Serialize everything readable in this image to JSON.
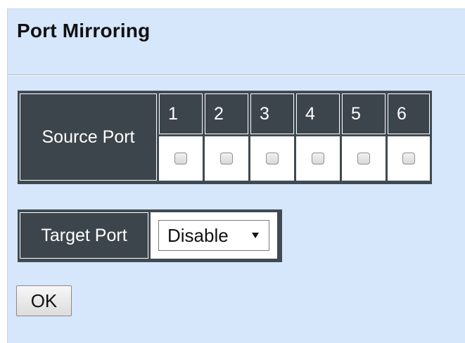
{
  "page": {
    "title": "Port Mirroring"
  },
  "source_port": {
    "label": "Source Port",
    "ports": [
      {
        "number": "1",
        "checked": false
      },
      {
        "number": "2",
        "checked": false
      },
      {
        "number": "3",
        "checked": false
      },
      {
        "number": "4",
        "checked": false
      },
      {
        "number": "5",
        "checked": false
      },
      {
        "number": "6",
        "checked": false
      }
    ]
  },
  "target_port": {
    "label": "Target Port",
    "selected": "Disable"
  },
  "actions": {
    "ok_label": "OK"
  },
  "colors": {
    "page_background": "#d6e6fb",
    "header_cell": "#3d454c",
    "header_text": "#ffffff"
  }
}
